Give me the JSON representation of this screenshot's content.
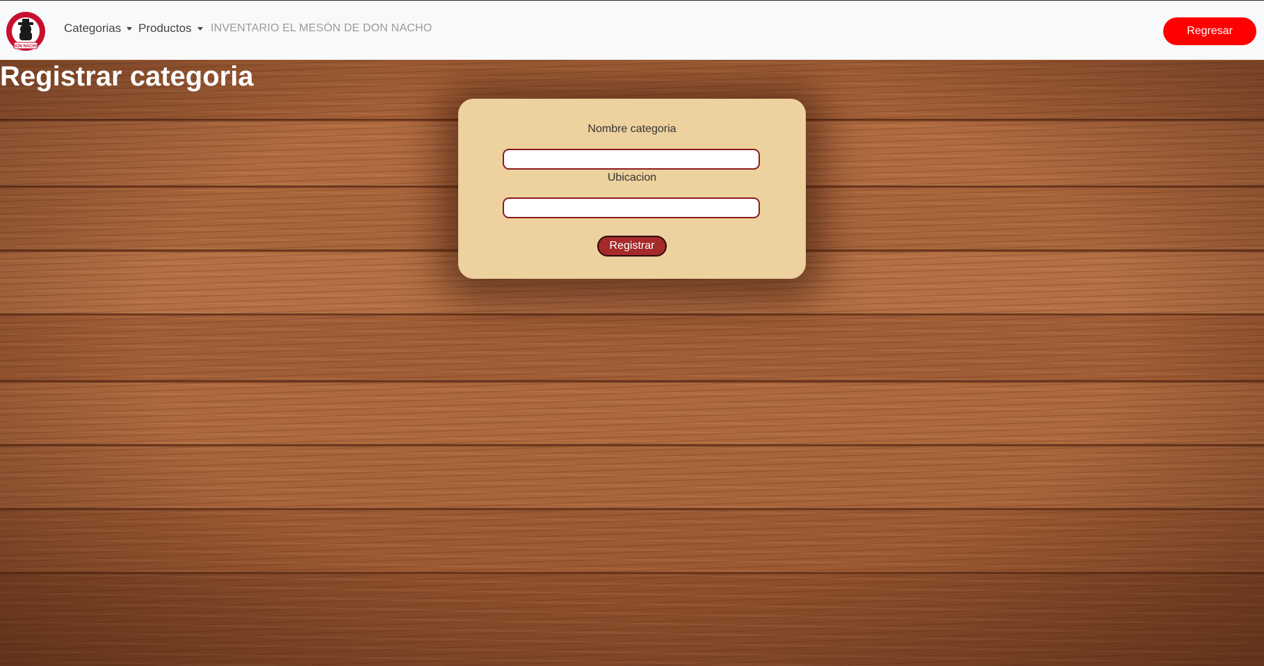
{
  "navbar": {
    "logo_icon": "restaurant-logo-icon",
    "logo_text_top": "RESTAURANTE EL MESON DE",
    "logo_text_bottom": "DON NACHO",
    "menu": [
      {
        "label": "Categorias"
      },
      {
        "label": "Productos"
      }
    ],
    "brand_text": "INVENTARIO EL MESÓN DE DON NACHO",
    "back_button": "Regresar"
  },
  "page": {
    "title": "Registrar categoria"
  },
  "form": {
    "name_label": "Nombre categoria",
    "name_value": "",
    "location_label": "Ubicacion",
    "location_value": "",
    "submit_label": "Registrar"
  },
  "colors": {
    "navbar_bg": "#f8f9fa",
    "back_button_bg": "#ff0000",
    "card_bg": "#edd19e",
    "input_border": "#8b1c1c",
    "submit_bg": "#a52a2a"
  }
}
